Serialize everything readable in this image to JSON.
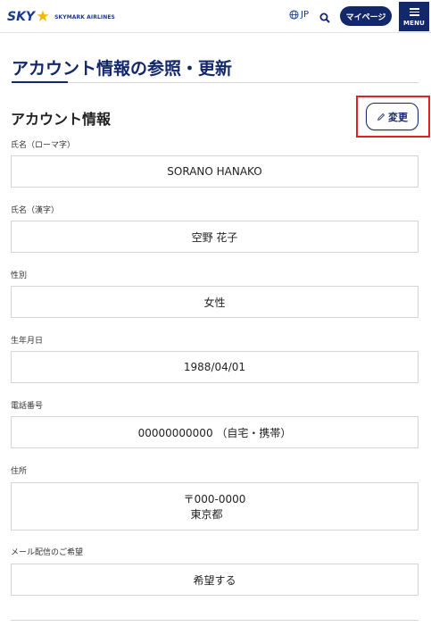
{
  "header": {
    "logo_text": "SKY",
    "logo_subtext": "SKYMARK AIRLINES",
    "language": "JP",
    "mypage_label": "マイページ",
    "menu_label": "MENU"
  },
  "page": {
    "title": "アカウント情報の参照・更新"
  },
  "section": {
    "title": "アカウント情報",
    "edit_label": "変更"
  },
  "fields": {
    "name_romaji": {
      "label": "氏名（ローマ字）",
      "value": "SORANO HANAKO"
    },
    "name_kanji": {
      "label": "氏名（漢字）",
      "value": "空野 花子"
    },
    "gender": {
      "label": "性別",
      "value": "女性"
    },
    "birthdate": {
      "label": "生年月日",
      "value": "1988/04/01"
    },
    "phone": {
      "label": "電話番号",
      "value": "00000000000 （自宅・携帯）"
    },
    "address": {
      "label": "住所",
      "postal": "〒000-0000",
      "prefecture": "東京都"
    },
    "newsletter": {
      "label": "メール配信のご希望",
      "value": "希望する"
    }
  },
  "colors": {
    "brand": "#13286b",
    "logo_star": "#f2b700",
    "highlight": "#e0202a"
  }
}
